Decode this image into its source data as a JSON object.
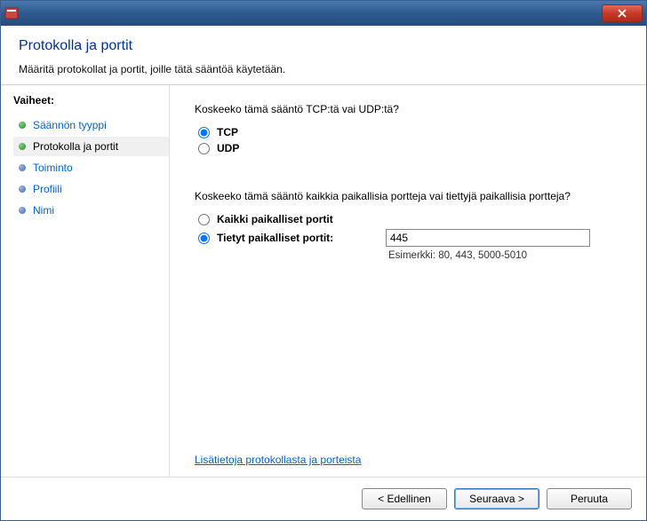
{
  "titlebar": {
    "title": ""
  },
  "header": {
    "title": "Protokolla ja portit",
    "subtitle": "Määritä protokollat ja portit, joille tätä sääntöä käytetään."
  },
  "sidebar": {
    "steps_label": "Vaiheet:",
    "steps": [
      {
        "label": "Säännön tyyppi",
        "done": true,
        "link": true
      },
      {
        "label": "Protokolla ja portit",
        "done": true,
        "current": true
      },
      {
        "label": "Toiminto"
      },
      {
        "label": "Profiili"
      },
      {
        "label": "Nimi"
      }
    ]
  },
  "content": {
    "protocol_question": "Koskeeko tämä sääntö TCP:tä vai UDP:tä?",
    "protocol_options": {
      "tcp": "TCP",
      "udp": "UDP"
    },
    "ports_question": "Koskeeko tämä sääntö kaikkia paikallisia portteja vai tiettyjä paikallisia portteja?",
    "ports_options": {
      "all": "Kaikki paikalliset portit",
      "specific": "Tietyt paikalliset portit:"
    },
    "port_value": "445",
    "port_example": "Esimerkki: 80, 443, 5000-5010",
    "more_link": "Lisätietoja protokollasta ja porteista"
  },
  "footer": {
    "back": "< Edellinen",
    "next": "Seuraava >",
    "cancel": "Peruuta"
  }
}
